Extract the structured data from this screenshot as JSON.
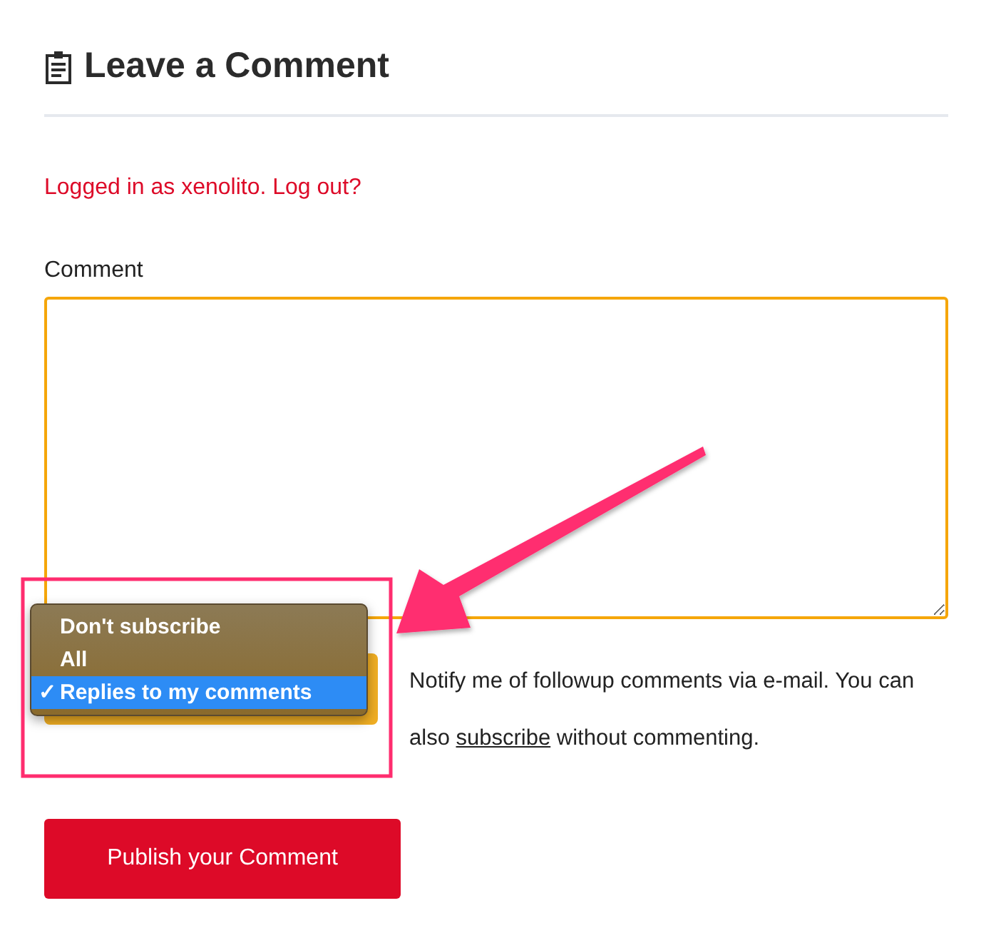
{
  "heading": {
    "title": "Leave a Comment"
  },
  "login": {
    "user_link": "Logged in as xenolito",
    "separator": ".",
    "logout_link": "Log out?"
  },
  "comment": {
    "label": "Comment"
  },
  "subscribe": {
    "options": [
      {
        "label": "Don't subscribe",
        "selected": false
      },
      {
        "label": "All",
        "selected": false
      },
      {
        "label": "Replies to my comments",
        "selected": true
      }
    ],
    "check_mark": "✓",
    "text_before": "Notify me of followup comments via e-mail. You can also",
    "link": "subscribe",
    "text_after": "without commenting."
  },
  "submit": {
    "label": "Publish your Comment"
  }
}
